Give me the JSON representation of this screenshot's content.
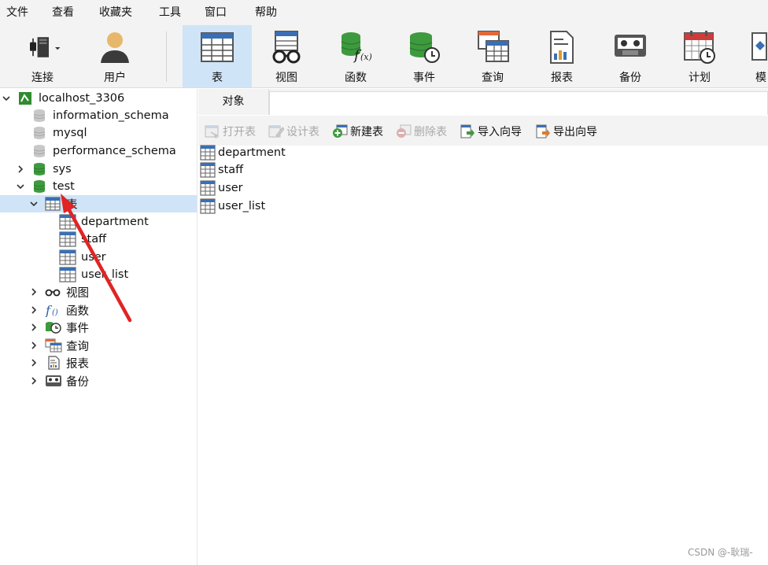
{
  "menu": [
    "文件",
    "查看",
    "收藏夹",
    "工具",
    "窗口",
    "帮助"
  ],
  "toolbar": {
    "connect": "连接",
    "user": "用户",
    "table": "表",
    "view": "视图",
    "function": "函数",
    "event": "事件",
    "query": "查询",
    "report": "报表",
    "backup": "备份",
    "schedule": "计划",
    "model": "模"
  },
  "tree": {
    "connection": "localhost_3306",
    "databases": [
      "information_schema",
      "mysql",
      "performance_schema",
      "sys",
      "test"
    ],
    "tables_group": "表",
    "tables": [
      "department",
      "staff",
      "user",
      "user_list"
    ],
    "groups": [
      "视图",
      "函数",
      "事件",
      "查询",
      "报表",
      "备份"
    ]
  },
  "tab": {
    "objects": "对象"
  },
  "objbar": {
    "open_table": "打开表",
    "design_table": "设计表",
    "new_table": "新建表",
    "delete_table": "删除表",
    "import_wizard": "导入向导",
    "export_wizard": "导出向导"
  },
  "objects": [
    "department",
    "staff",
    "user",
    "user_list"
  ],
  "watermark": "CSDN @-耿瑞-",
  "colors": {
    "accent": "#cfe4f7",
    "db_green": "#3e9a3e",
    "arrow_red": "#e02424",
    "table_blue": "#3a6fb5"
  },
  "icons": {
    "connect": "plug-icon",
    "user": "user-icon",
    "table": "table-icon",
    "view": "glasses-icon",
    "function": "function-icon",
    "event": "event-clock-icon",
    "query": "query-icon",
    "report": "report-icon",
    "backup": "backup-icon",
    "schedule": "calendar-icon"
  }
}
